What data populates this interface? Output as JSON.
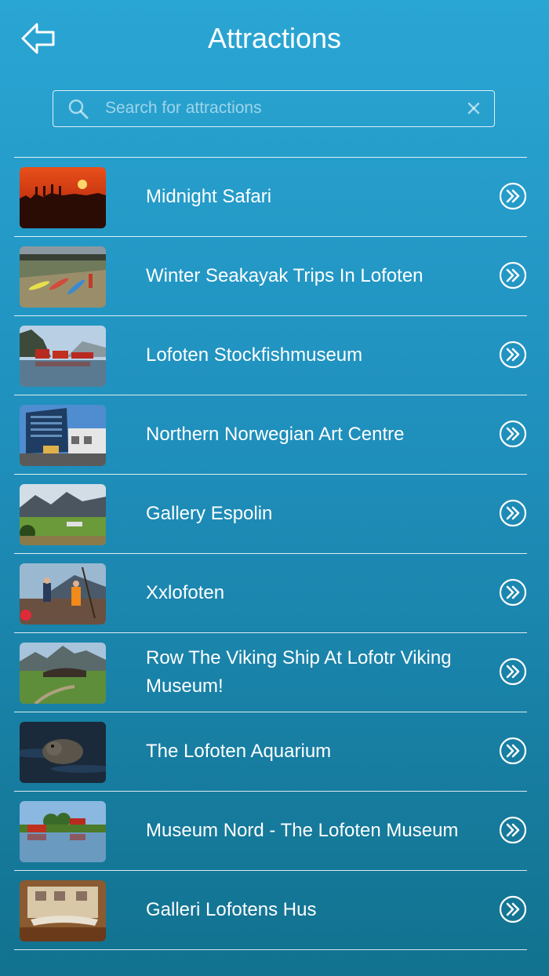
{
  "header": {
    "title": "Attractions",
    "back_icon": "back-arrow-icon"
  },
  "search": {
    "placeholder": "Search for attractions",
    "value": "",
    "search_icon": "search-icon",
    "clear_icon": "clear-icon"
  },
  "attractions": [
    {
      "label": "Midnight Safari",
      "thumbnail": "sunset-silhouettes-thumbnail"
    },
    {
      "label": "Winter Seakayak Trips In Lofoten",
      "thumbnail": "kayaks-on-shore-thumbnail"
    },
    {
      "label": "Lofoten Stockfishmuseum",
      "thumbnail": "red-houses-by-water-thumbnail"
    },
    {
      "label": "Northern Norwegian Art Centre",
      "thumbnail": "modern-building-thumbnail"
    },
    {
      "label": "Gallery Espolin",
      "thumbnail": "mountain-landscape-thumbnail"
    },
    {
      "label": "Xxlofoten",
      "thumbnail": "fishermen-on-boat-thumbnail"
    },
    {
      "label": "Row The Viking Ship At Lofotr Viking Museum!",
      "thumbnail": "viking-longhouse-thumbnail"
    },
    {
      "label": "The Lofoten Aquarium",
      "thumbnail": "seal-in-water-thumbnail"
    },
    {
      "label": "Museum Nord - The Lofoten Museum",
      "thumbnail": "village-reflection-thumbnail"
    },
    {
      "label": "Galleri Lofotens Hus",
      "thumbnail": "gallery-interior-thumbnail"
    }
  ],
  "colors": {
    "background_top": "#2aa6d4",
    "background_bottom": "#12728f",
    "foreground": "#ffffff"
  }
}
